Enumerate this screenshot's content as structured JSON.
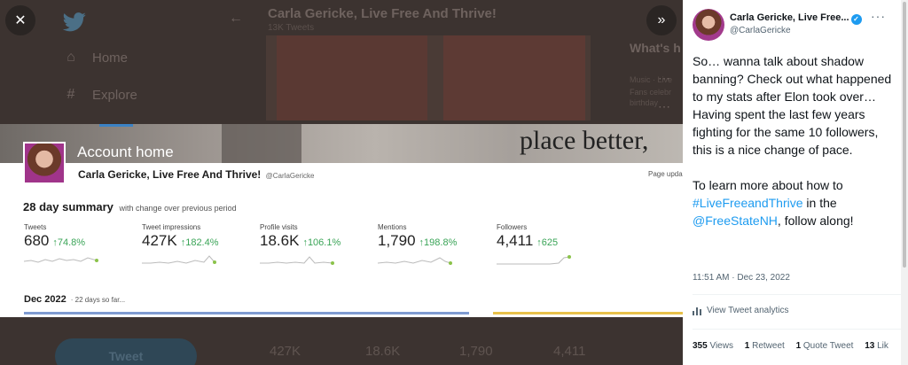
{
  "background": {
    "nav": [
      {
        "icon": "home-icon",
        "label": "Home"
      },
      {
        "icon": "hashtag-icon",
        "label": "Explore"
      }
    ],
    "header_name": "Carla Gericke, Live Free And Thrive!",
    "header_sub": "13K Tweets",
    "right_title": "What's h",
    "right_lines": [
      "Music · Live",
      "Fans celebr",
      "birthday"
    ],
    "tweet_button": "Tweet",
    "lower_values": [
      "427K",
      "18.6K",
      "1,790",
      "4,411"
    ]
  },
  "analytics": {
    "title": "Account home",
    "banner_text": "place better,",
    "name": "Carla Gericke, Live Free And Thrive!",
    "handle": "@CarlaGericke",
    "page_updated": "Page upda",
    "summary_title": "28 day summary",
    "summary_sub": "with change over previous period",
    "metrics": [
      {
        "label": "Tweets",
        "value": "680",
        "change": "↑74.8%"
      },
      {
        "label": "Tweet impressions",
        "value": "427K",
        "change": "↑182.4%"
      },
      {
        "label": "Profile visits",
        "value": "18.6K",
        "change": "↑106.1%"
      },
      {
        "label": "Mentions",
        "value": "1,790",
        "change": "↑198.8%"
      },
      {
        "label": "Followers",
        "value": "4,411",
        "change": "↑625"
      }
    ],
    "month": "Dec 2022",
    "month_sub": "· 22 days so far..."
  },
  "tweet": {
    "name": "Carla Gericke, Live Free...",
    "handle": "@CarlaGericke",
    "para1": "So… wanna talk about shadow banning? Check out what happened to my stats after Elon took over… Having spent the last few years fighting for the same 10 followers, this is a nice change of pace.",
    "para2_pre": "To learn more about how to ",
    "hashtag": "#LiveFreeandThrive",
    "para2_mid": " in the ",
    "mention": "@FreeStateNH",
    "para2_post": ", follow along!",
    "time": "11:51 AM · Dec 23, 2022",
    "analytics_label": "View Tweet analytics",
    "stats": [
      {
        "count": "355",
        "label": "Views"
      },
      {
        "count": "1",
        "label": "Retweet"
      },
      {
        "count": "1",
        "label": "Quote Tweet"
      },
      {
        "count": "13",
        "label": "Lik"
      }
    ]
  },
  "colors": {
    "accent": "#1d9bf0",
    "positive": "#3aa457"
  }
}
